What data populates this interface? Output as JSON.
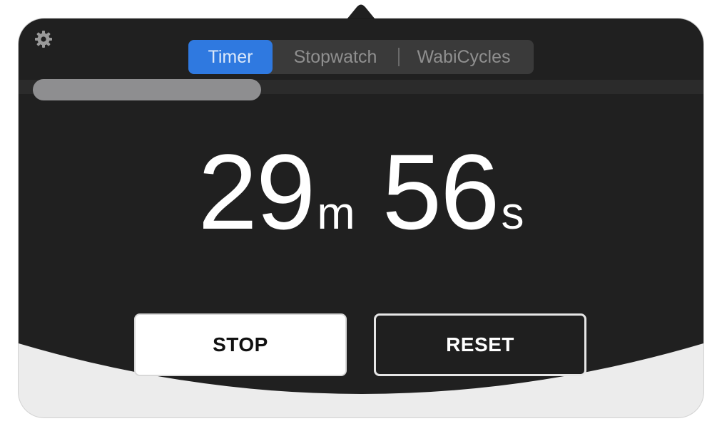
{
  "app": {
    "colors": {
      "panel_background": "#202020",
      "segment_background": "#3a3a3a",
      "accent": "#2f79e0",
      "progress_fill": "#8e8e90",
      "bottom_background": "#ececec"
    }
  },
  "toolbar": {
    "settings_icon": "gear-icon"
  },
  "tabs": [
    {
      "label": "Timer",
      "active": true
    },
    {
      "label": "Stopwatch",
      "active": false
    },
    {
      "label": "WabiCycles",
      "active": false
    }
  ],
  "progress": {
    "elapsed_fraction": 0.34
  },
  "timer": {
    "minutes": "29",
    "minutes_unit": "m",
    "seconds": "56",
    "seconds_unit": "s"
  },
  "actions": {
    "stop_label": "STOP",
    "reset_label": "RESET"
  }
}
